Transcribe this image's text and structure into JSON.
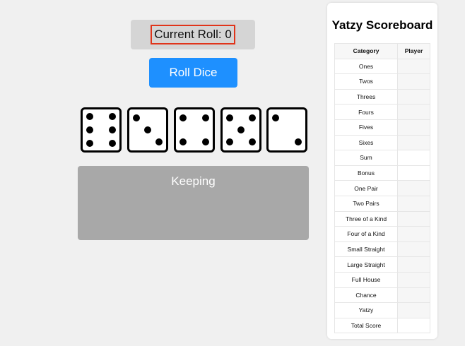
{
  "current_roll": {
    "label": "Current Roll: 0"
  },
  "roll_button": {
    "label": "Roll Dice"
  },
  "dice": [
    {
      "value": 6
    },
    {
      "value": 3
    },
    {
      "value": 4
    },
    {
      "value": 5
    },
    {
      "value": 2
    }
  ],
  "keeping": {
    "label": "Keeping"
  },
  "scoreboard": {
    "title": "Yatzy Scoreboard",
    "headers": {
      "category": "Category",
      "player": "Player"
    },
    "rows": [
      {
        "category": "Ones",
        "score": ""
      },
      {
        "category": "Twos",
        "score": ""
      },
      {
        "category": "Threes",
        "score": ""
      },
      {
        "category": "Fours",
        "score": ""
      },
      {
        "category": "Fives",
        "score": ""
      },
      {
        "category": "Sixes",
        "score": ""
      },
      {
        "category": "Sum",
        "score": ""
      },
      {
        "category": "Bonus",
        "score": ""
      },
      {
        "category": "One Pair",
        "score": ""
      },
      {
        "category": "Two Pairs",
        "score": ""
      },
      {
        "category": "Three of a Kind",
        "score": ""
      },
      {
        "category": "Four of a Kind",
        "score": ""
      },
      {
        "category": "Small Straight",
        "score": ""
      },
      {
        "category": "Large Straight",
        "score": ""
      },
      {
        "category": "Full House",
        "score": ""
      },
      {
        "category": "Chance",
        "score": ""
      },
      {
        "category": "Yatzy",
        "score": ""
      },
      {
        "category": "Total Score",
        "score": ""
      }
    ]
  },
  "colors": {
    "background": "#f0f0f0",
    "roll_button": "#1e90ff",
    "roll_highlight_border": "#e0341a",
    "keeping_area": "#a8a8a8"
  }
}
